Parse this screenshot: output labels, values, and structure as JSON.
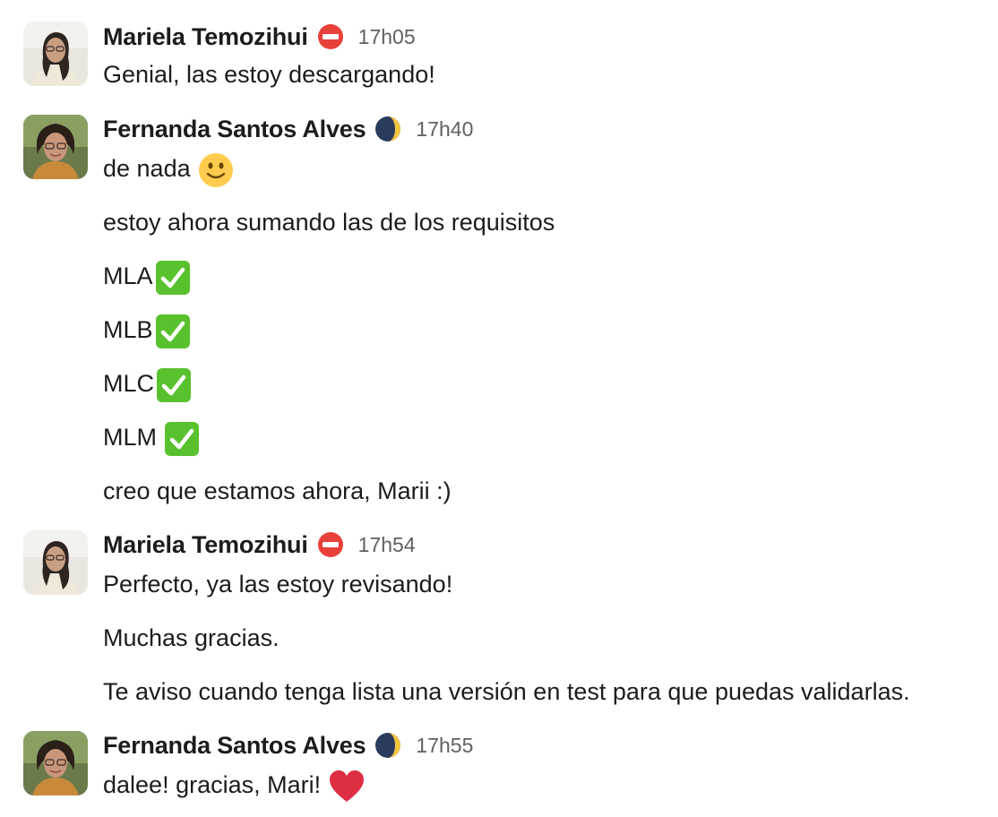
{
  "messages": [
    {
      "author": "Mariela Temozihui",
      "status_icon": "no-entry-icon",
      "time": "17h05",
      "lines": [
        "Genial, las estoy descargando!"
      ]
    },
    {
      "author": "Fernanda Santos Alves",
      "status_icon": "moon-icon",
      "time": "17h40",
      "lines": [
        "de nada",
        "estoy ahora sumando las de los requisitos",
        "MLA",
        "MLB",
        "MLC",
        "MLM",
        "creo que estamos ahora, Marii :)"
      ],
      "line_emojis": [
        "slightly-smiling-face-icon",
        "",
        "check-mark-icon",
        "check-mark-icon",
        "check-mark-icon",
        "check-mark-icon",
        ""
      ]
    },
    {
      "author": "Mariela Temozihui",
      "status_icon": "no-entry-icon",
      "time": "17h54",
      "lines": [
        "Perfecto, ya las estoy revisando!",
        "Muchas gracias.",
        "Te aviso cuando tenga lista una versión en test para que puedas validarlas."
      ]
    },
    {
      "author": "Fernanda Santos Alves",
      "status_icon": "moon-icon",
      "time": "17h55",
      "lines": [
        "dalee! gracias, Mari!"
      ],
      "line_emojis": [
        "red-heart-icon"
      ]
    }
  ],
  "colors": {
    "text": "#1d1c1d",
    "timestamp": "#616061",
    "status_red": "#e8403a",
    "check_green": "#5ac12e",
    "heart_red": "#dd2e44"
  }
}
